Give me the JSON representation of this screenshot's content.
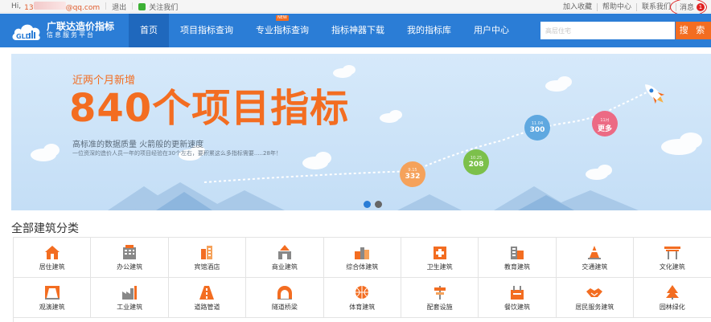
{
  "topbar": {
    "greeting": "Hi,",
    "user_prefix": "13",
    "user_suffix": "@qq.com",
    "logout": "退出",
    "follow": "关注我们",
    "links": [
      "加入收藏",
      "帮助中心",
      "联系我们"
    ],
    "message_label": "消息",
    "message_count": "1"
  },
  "logo": {
    "title": "广联达造价指标",
    "subtitle": "信息服务平台",
    "mark": "GLD"
  },
  "nav": {
    "items": [
      {
        "label": "首页"
      },
      {
        "label": "项目指标查询"
      },
      {
        "label": "专业指标查询",
        "tag": "NEW"
      },
      {
        "label": "指标神器下载"
      },
      {
        "label": "我的指标库"
      },
      {
        "label": "用户中心"
      }
    ],
    "search_placeholder": "高层住宅",
    "search_button": "搜 索"
  },
  "banner": {
    "line1": "近两个月新增",
    "headline": "840个项目指标",
    "line2": "高标准的数据质量   火箭般的更新速度",
    "line3": "一位资深的造价人员一年的项目经验在30个左右，要积累这么多指标需要.....28年！",
    "bubbles": [
      {
        "date": "9.15",
        "value": "332",
        "color": "#f5a25b"
      },
      {
        "date": "10.25",
        "value": "208",
        "color": "#7cc04b"
      },
      {
        "date": "11.04",
        "value": "300",
        "color": "#5fa8e0"
      },
      {
        "date": "11月",
        "value": "更多",
        "color": "#ec6a84"
      }
    ],
    "slide_dots": 2,
    "active_slide": 1
  },
  "categories": {
    "title": "全部建筑分类",
    "items": [
      {
        "label": "居住建筑",
        "icon": "house-icon"
      },
      {
        "label": "办公建筑",
        "icon": "office-icon"
      },
      {
        "label": "宾馆酒店",
        "icon": "hotel-icon"
      },
      {
        "label": "商业建筑",
        "icon": "commerce-icon"
      },
      {
        "label": "综合体建筑",
        "icon": "complex-icon"
      },
      {
        "label": "卫生建筑",
        "icon": "hospital-icon"
      },
      {
        "label": "教育建筑",
        "icon": "school-icon"
      },
      {
        "label": "交通建筑",
        "icon": "traffic-cone-icon"
      },
      {
        "label": "文化建筑",
        "icon": "gate-icon"
      },
      {
        "label": "观演建筑",
        "icon": "stage-icon"
      },
      {
        "label": "工业建筑",
        "icon": "factory-icon"
      },
      {
        "label": "道路管道",
        "icon": "road-icon"
      },
      {
        "label": "隧道桥梁",
        "icon": "tunnel-icon"
      },
      {
        "label": "体育建筑",
        "icon": "ball-icon"
      },
      {
        "label": "配套设施",
        "icon": "facility-icon"
      },
      {
        "label": "餐饮建筑",
        "icon": "dining-icon"
      },
      {
        "label": "居民服务建筑",
        "icon": "handshake-icon"
      },
      {
        "label": "园林绿化",
        "icon": "tree-icon"
      }
    ]
  },
  "colors": {
    "nav_blue": "#2b7dd6",
    "accent_orange": "#f36d21",
    "banner_bg": "#cfe4f8"
  }
}
